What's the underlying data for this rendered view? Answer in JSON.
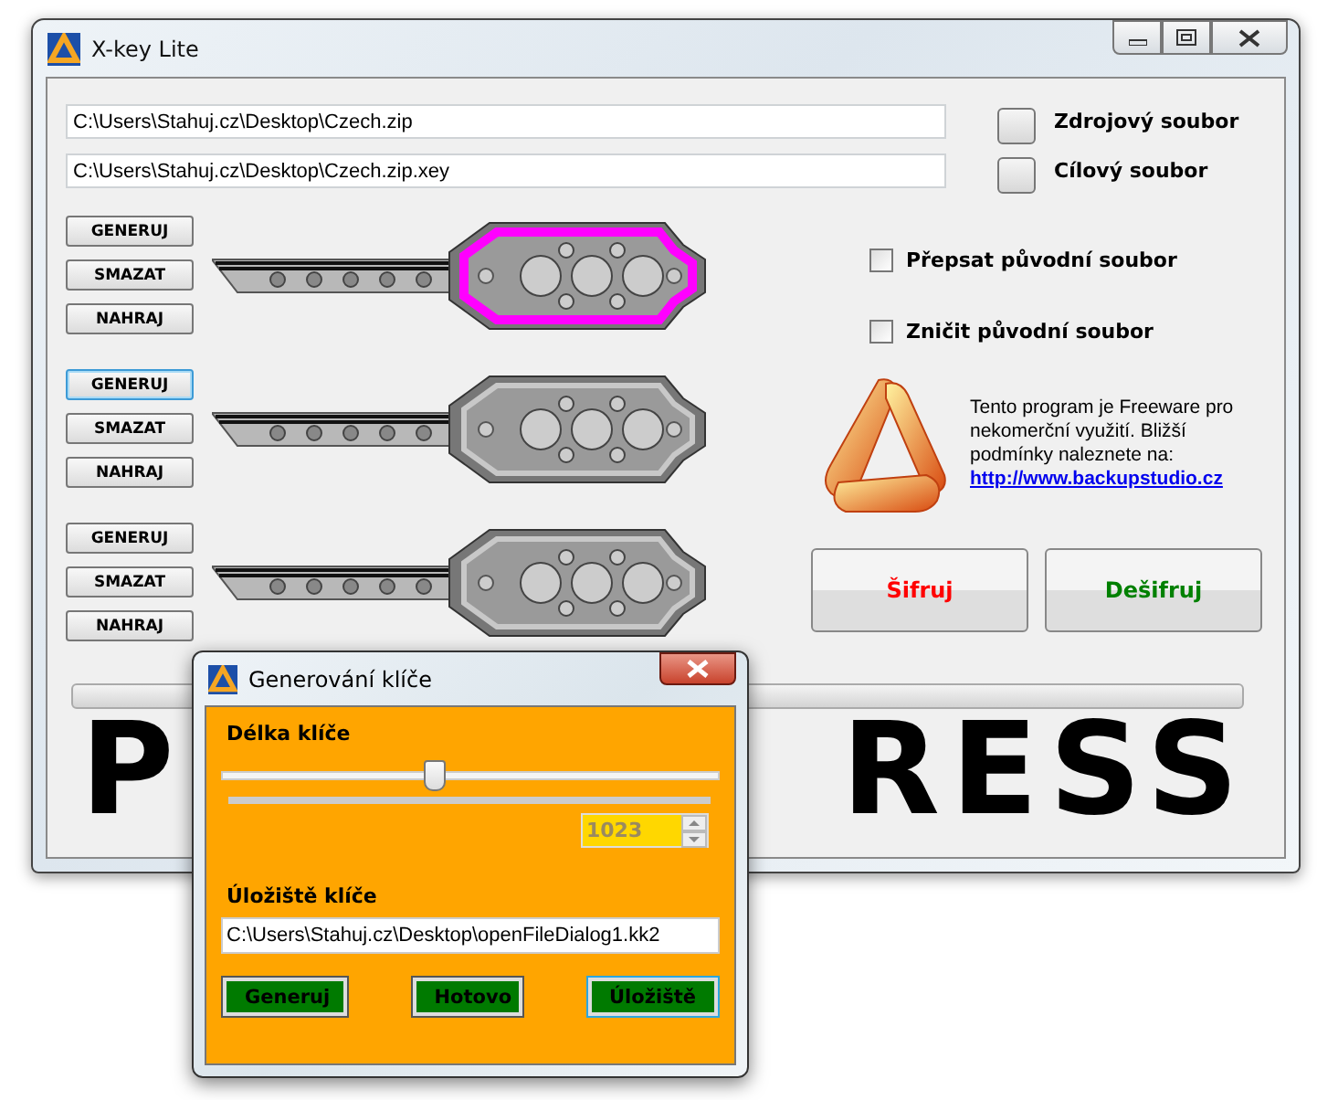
{
  "window": {
    "title": "X-key Lite"
  },
  "files": [
    {
      "path": "C:\\Users\\Stahuj.cz\\Desktop\\Czech.zip",
      "label": "Zdrojový soubor"
    },
    {
      "path": "C:\\Users\\Stahuj.cz\\Desktop\\Czech.zip.xey",
      "label": "Cílový soubor"
    }
  ],
  "keys": [
    {
      "highlighted": true,
      "buttons": [
        {
          "label": "GENERUJ",
          "focused": false
        },
        {
          "label": "SMAZAT",
          "focused": false
        },
        {
          "label": "NAHRAJ",
          "focused": false
        }
      ]
    },
    {
      "highlighted": false,
      "buttons": [
        {
          "label": "GENERUJ",
          "focused": true
        },
        {
          "label": "SMAZAT",
          "focused": false
        },
        {
          "label": "NAHRAJ",
          "focused": false
        }
      ]
    },
    {
      "highlighted": false,
      "buttons": [
        {
          "label": "GENERUJ",
          "focused": false
        },
        {
          "label": "SMAZAT",
          "focused": false
        },
        {
          "label": "NAHRAJ",
          "focused": false
        }
      ]
    }
  ],
  "options": [
    {
      "label": "Přepsat původní soubor",
      "checked": false
    },
    {
      "label": "Zničit původní soubor",
      "checked": false
    }
  ],
  "info": {
    "text": "Tento program je Freeware pro nekomerční využití. Bližší podmínky naleznete na:",
    "link": "http://www.backupstudio.cz"
  },
  "actions": [
    {
      "label": "Šifruj",
      "color": "#ff0000"
    },
    {
      "label": "Dešifruj",
      "color": "#008000"
    }
  ],
  "progress": {
    "level": 0
  },
  "banner": {
    "parts": [
      "P",
      "RESS"
    ]
  },
  "dialog": {
    "title": "Generování klíče",
    "length_label": "Délka klíče",
    "slider": {
      "level": 0.43
    },
    "spinner": {
      "value": "1023"
    },
    "storage_label": "Úložiště klíče",
    "storage_path": "C:\\Users\\Stahuj.cz\\Desktop\\openFileDialog1.kk2",
    "buttons": [
      {
        "label": "Generuj",
        "focused": false
      },
      {
        "label": "Hotovo",
        "focused": false
      },
      {
        "label": "Úložiště",
        "focused": true
      }
    ]
  }
}
